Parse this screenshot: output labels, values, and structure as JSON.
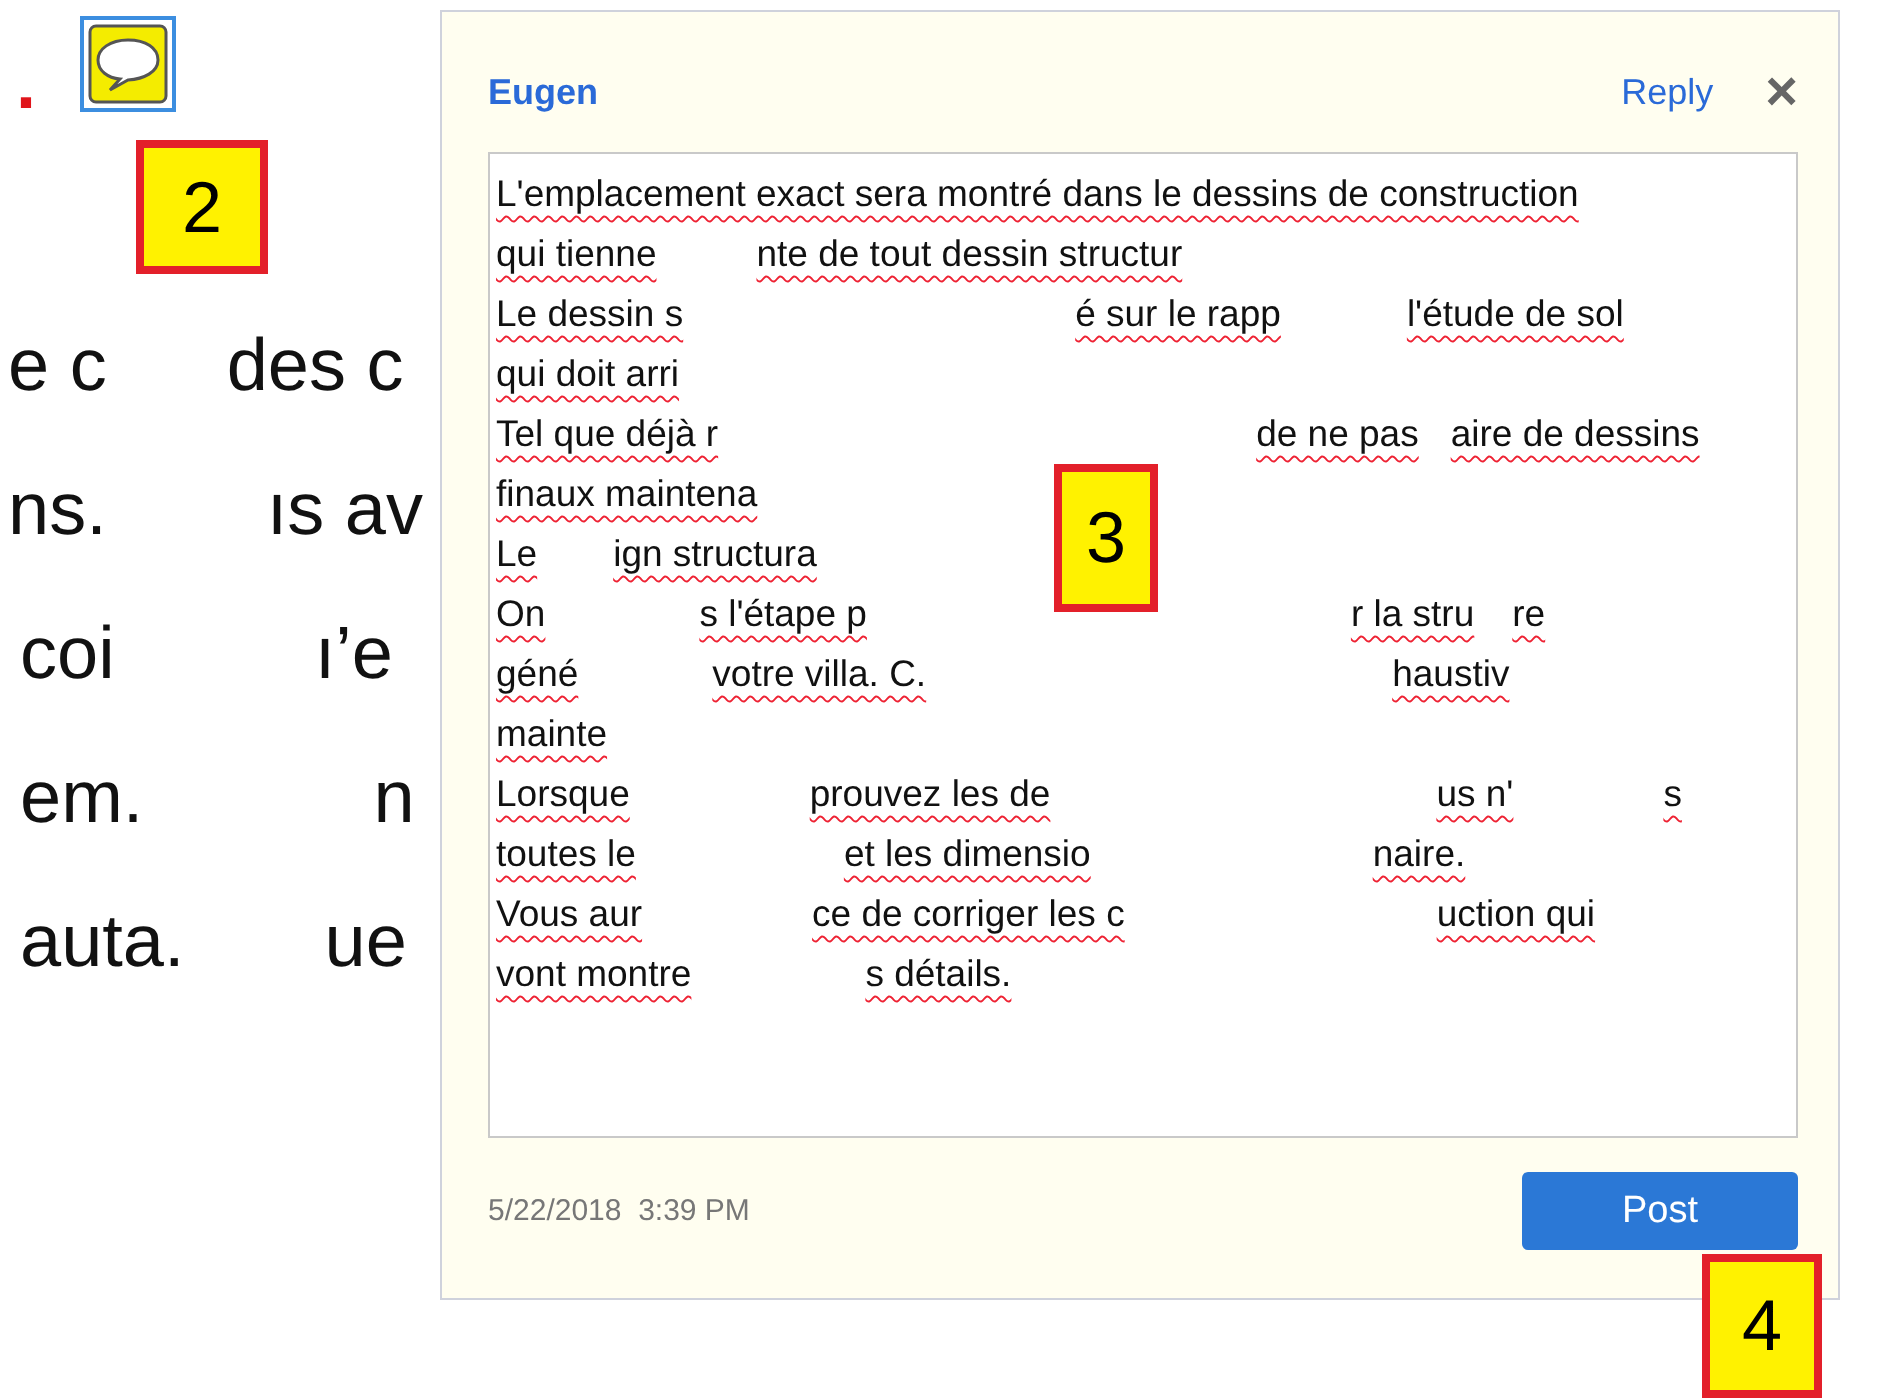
{
  "document": {
    "marker": ".",
    "lines": [
      {
        "fragments": [
          "e c",
          "des c"
        ]
      },
      {
        "fragments": [
          "ns.",
          "ıs av"
        ]
      },
      {
        "fragments": [
          "coi",
          "ı’e"
        ]
      },
      {
        "fragments": [
          "em.",
          "n"
        ]
      },
      {
        "fragments": [
          "auta.",
          "ue"
        ]
      }
    ]
  },
  "comment": {
    "author": "Eugen",
    "reply": "Reply",
    "close": "×",
    "lines": [
      {
        "fragments": [
          "L'emplacement exact sera montré dans le dessins de construction"
        ]
      },
      {
        "fragments": [
          "qui tienne",
          "nte de tout dessin structur"
        ]
      },
      {
        "fragments": [
          "Le dessin s",
          "é sur le rapp",
          "l'étude de sol"
        ]
      },
      {
        "fragments": [
          "qui doit arri"
        ]
      },
      {
        "fragments": [
          "Tel que déjà r",
          "de ne pas",
          "aire de dessins"
        ]
      },
      {
        "fragments": [
          "finaux maintena"
        ]
      },
      {
        "fragments": [
          "Le",
          "ign structura"
        ]
      },
      {
        "fragments": [
          "On",
          "s l'étape p",
          "r la stru",
          "re"
        ]
      },
      {
        "fragments": [
          "géné",
          "votre villa. C.",
          "haustiv"
        ]
      },
      {
        "fragments": [
          "mainte"
        ]
      },
      {
        "fragments": [
          "Lorsque",
          "prouvez les de",
          "us n'",
          "s"
        ]
      },
      {
        "fragments": [
          "toutes le",
          "et les dimensio",
          "naire."
        ]
      },
      {
        "fragments": [
          "Vous aur",
          "ce de corriger les c",
          "uction qui"
        ]
      },
      {
        "fragments": [
          "vont montre",
          "s détails."
        ]
      }
    ],
    "timestamp": "5/22/2018  3:39 PM",
    "post": "Post"
  },
  "callouts": [
    {
      "label": "2"
    },
    {
      "label": "3"
    },
    {
      "label": "4"
    }
  ]
}
